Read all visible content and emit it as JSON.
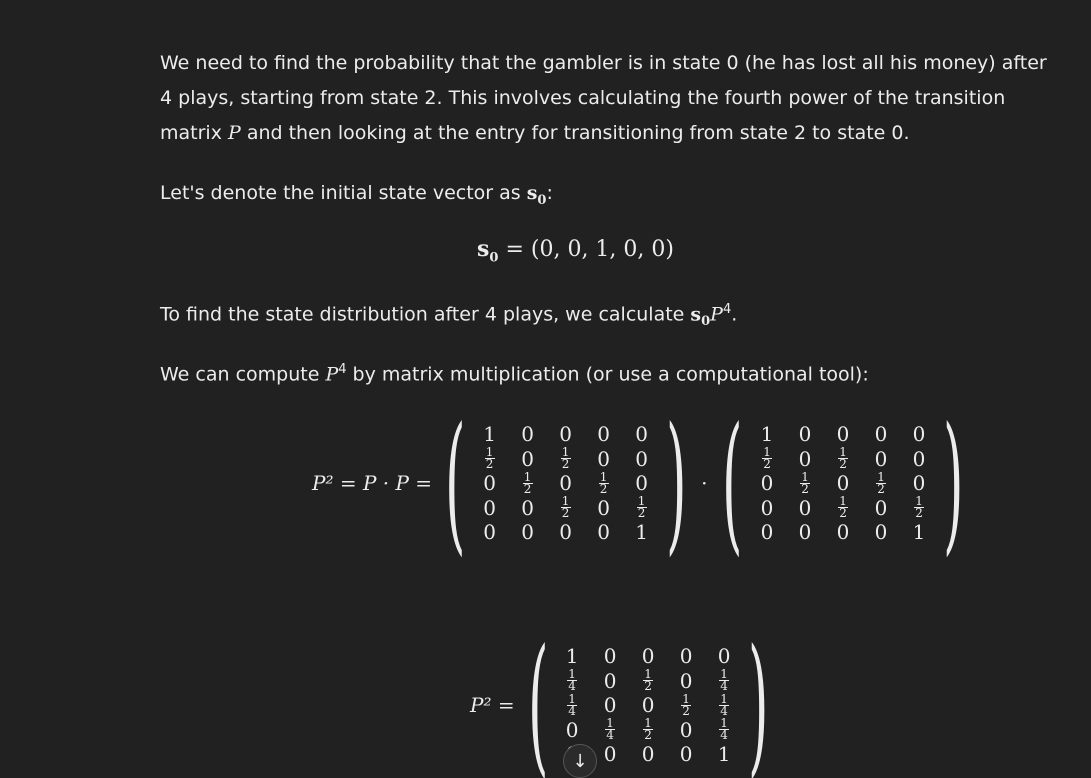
{
  "paragraphs": {
    "p1_a": "We need to find the probability that the gambler is in state 0 (he has lost all his money) after 4 plays, starting from state 2. This involves calculating the fourth power of the transition matrix ",
    "p1_var": "P",
    "p1_b": " and then looking at the entry for transitioning from state 2 to state 0.",
    "p2_a": "Let's denote the initial state vector as ",
    "p2_var": "s",
    "p2_sub": "0",
    "p2_b": ":",
    "p3_a": "To find the state distribution after 4 plays, we calculate ",
    "p3_var": "s",
    "p3_sub": "0",
    "p3_var2": "P",
    "p3_sup": "4",
    "p3_b": ".",
    "p4_a": "We can compute ",
    "p4_var": "P",
    "p4_sup": "4",
    "p4_b": " by matrix multiplication (or use a computational tool):"
  },
  "equation1": {
    "lhs_var": "s",
    "lhs_sub": "0",
    "rhs": "= (0, 0, 1, 0, 0)"
  },
  "equation2": {
    "lhs": "P² = P · P =",
    "dot": "·",
    "matrix_a": [
      [
        "1",
        "0",
        "0",
        "0",
        "0"
      ],
      [
        "1/2",
        "0",
        "1/2",
        "0",
        "0"
      ],
      [
        "0",
        "1/2",
        "0",
        "1/2",
        "0"
      ],
      [
        "0",
        "0",
        "1/2",
        "0",
        "1/2"
      ],
      [
        "0",
        "0",
        "0",
        "0",
        "1"
      ]
    ],
    "matrix_b": [
      [
        "1",
        "0",
        "0",
        "0",
        "0"
      ],
      [
        "1/2",
        "0",
        "1/2",
        "0",
        "0"
      ],
      [
        "0",
        "1/2",
        "0",
        "1/2",
        "0"
      ],
      [
        "0",
        "0",
        "1/2",
        "0",
        "1/2"
      ],
      [
        "0",
        "0",
        "0",
        "0",
        "1"
      ]
    ]
  },
  "equation3": {
    "lhs": "P² =",
    "matrix": [
      [
        "1",
        "0",
        "0",
        "0",
        "0"
      ],
      [
        "1/4",
        "0",
        "1/2",
        "0",
        "1/4"
      ],
      [
        "1/4",
        "0",
        "0",
        "1/2",
        "1/4"
      ],
      [
        "0",
        "1/4",
        "1/2",
        "0",
        "1/4"
      ],
      [
        "0",
        "0",
        "0",
        "0",
        "1"
      ]
    ]
  },
  "scroll_button": {
    "icon": "arrow-down-icon",
    "glyph": "↓"
  }
}
